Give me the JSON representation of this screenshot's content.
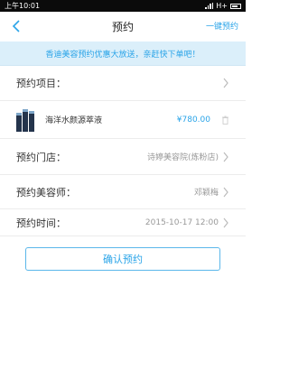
{
  "status_bar": {
    "time": "上午10:01",
    "network": "H+"
  },
  "nav": {
    "title": "预约",
    "action": "一键预约"
  },
  "promo_text": "香迪美容预约优惠大放送，亲赶快下单吧！",
  "rows": {
    "item": {
      "label": "预约项目："
    },
    "product": {
      "name": "海洋水颜源萃液",
      "price": "¥780.00"
    },
    "store": {
      "label": "预约门店：",
      "value": "诗婷美容院(炼粉店)"
    },
    "beautician": {
      "label": "预约美容师：",
      "value": "邓颖梅"
    },
    "time": {
      "label": "预约时间：",
      "value": "2015-10-17  12:00"
    }
  },
  "confirm_button": "确认预约",
  "colors": {
    "accent": "#2aa4e8",
    "promo_bg": "#dbeffa",
    "status_bar": "#0b0b0b"
  }
}
